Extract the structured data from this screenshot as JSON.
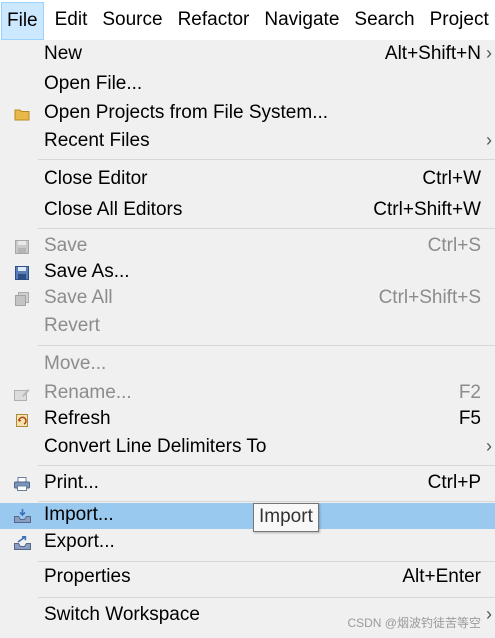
{
  "menubar": {
    "items": [
      "File",
      "Edit",
      "Source",
      "Refactor",
      "Navigate",
      "Search",
      "Project"
    ]
  },
  "menu": {
    "new": {
      "label": "New",
      "shortcut": "Alt+Shift+N"
    },
    "open_file": {
      "label": "Open File..."
    },
    "open_projects": {
      "label": "Open Projects from File System..."
    },
    "recent_files": {
      "label": "Recent Files"
    },
    "close_editor": {
      "label": "Close Editor",
      "shortcut": "Ctrl+W"
    },
    "close_all": {
      "label": "Close All Editors",
      "shortcut": "Ctrl+Shift+W"
    },
    "save": {
      "label": "Save",
      "shortcut": "Ctrl+S"
    },
    "save_as": {
      "label": "Save As..."
    },
    "save_all": {
      "label": "Save All",
      "shortcut": "Ctrl+Shift+S"
    },
    "revert": {
      "label": "Revert"
    },
    "move": {
      "label": "Move..."
    },
    "rename": {
      "label": "Rename...",
      "shortcut": "F2"
    },
    "refresh": {
      "label": "Refresh",
      "shortcut": "F5"
    },
    "convert": {
      "label": "Convert Line Delimiters To"
    },
    "print": {
      "label": "Print...",
      "shortcut": "Ctrl+P"
    },
    "import": {
      "label": "Import..."
    },
    "export": {
      "label": "Export..."
    },
    "properties": {
      "label": "Properties",
      "shortcut": "Alt+Enter"
    },
    "switch_workspace": {
      "label": "Switch Workspace"
    }
  },
  "tooltip": {
    "text": "Import"
  },
  "watermark": {
    "text": "CSDN @烟波钓徒苦等空"
  },
  "colors": {
    "highlight": "#99c9ef",
    "active_menu": "#cce8ff",
    "disabled_text": "#8c8c8c"
  }
}
